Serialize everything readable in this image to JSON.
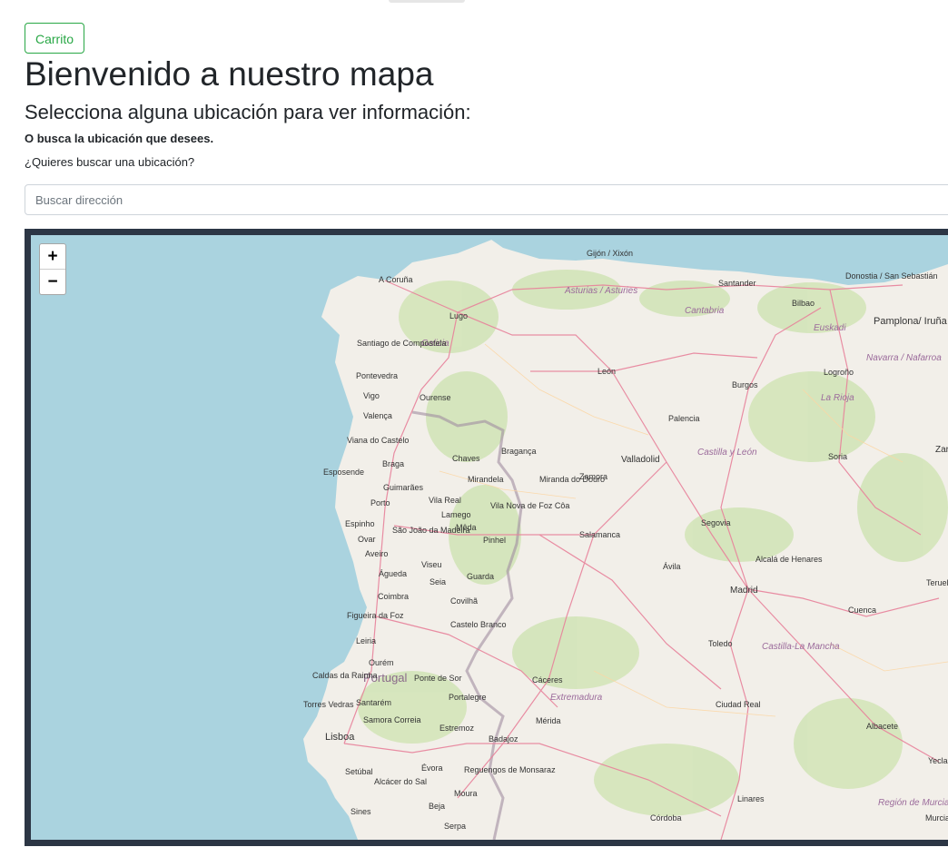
{
  "header": {
    "cart_label": "Carrito",
    "title": "Bienvenido a nuestro mapa",
    "subtitle": "Selecciona alguna ubicación para ver información:",
    "hint": "O busca la ubicación que desees.",
    "question": "¿Quieres buscar una ubicación?"
  },
  "search": {
    "placeholder": "Buscar dirección",
    "value": ""
  },
  "map": {
    "zoom_in": "+",
    "zoom_out": "−",
    "country": "Portugal",
    "regions": [
      "Asturias / Asturies",
      "Cantabria",
      "Euskadi",
      "Galicia",
      "Navarra / Nafarroa",
      "La Rioja",
      "Castilla y León",
      "Castilla-La Mancha",
      "Extremadura",
      "Región de Murcia"
    ],
    "cities": [
      "Gijón / Xixón",
      "A Coruña",
      "Santander",
      "Bilbao",
      "Donostia / San Sebastián",
      "Pamplona/ Iruña",
      "Lugo",
      "Santiago de Compostela",
      "Pontevedra",
      "Logroño",
      "León",
      "Burgos",
      "Vigo",
      "Ourense",
      "Valença",
      "Palencia",
      "Viana do Castelo",
      "Bragança",
      "Chaves",
      "Valladolid",
      "Soria",
      "Braga",
      "Esposende",
      "Guimarães",
      "Mirandela",
      "Miranda do Douro",
      "Zamora",
      "Porto",
      "Vila Real",
      "Vila Nova de Foz Côa",
      "Lamego",
      "Espinho",
      "São João da Madeira",
      "Mêda",
      "Ovar",
      "Pinhel",
      "Salamanca",
      "Segovia",
      "Aveiro",
      "Águeda",
      "Viseu",
      "Seia",
      "Guarda",
      "Ávila",
      "Alcalá de Henares",
      "Madrid",
      "Coimbra",
      "Covilhã",
      "Cuenca",
      "Figueira da Foz",
      "Castelo Branco",
      "Leiria",
      "Toledo",
      "Ourém",
      "Caldas da Rainha",
      "Ponte de Sor",
      "Cáceres",
      "Torres Vedras",
      "Santarém",
      "Portalegre",
      "Ciudad Real",
      "Lisboa",
      "Samora Correia",
      "Estremoz",
      "Mérida",
      "Albacete",
      "Badajoz",
      "Setúbal",
      "Évora",
      "Reguengos de Monsaraz",
      "Alcácer do Sal",
      "Moura",
      "Linares",
      "Sines",
      "Beja",
      "Serpa",
      "Córdoba",
      "Teruel",
      "Yecla",
      "Zar",
      "Murcia"
    ]
  },
  "colors": {
    "accent": "#28a745",
    "map_frame": "#2c3645",
    "sea": "#aad3df",
    "land": "#f2efe9",
    "road": "#e8829b",
    "border": "#a08ca0"
  }
}
